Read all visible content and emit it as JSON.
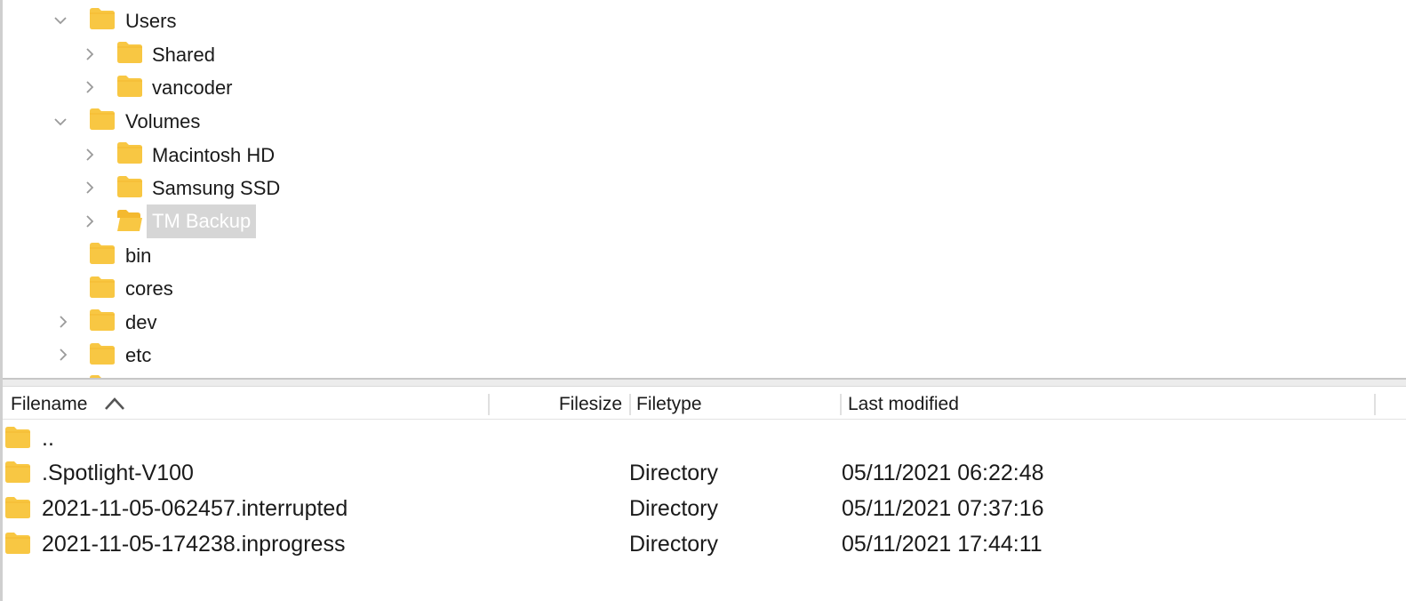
{
  "colors": {
    "folder": "#f8c743",
    "folder_tab": "#f4b92f",
    "selection_bg": "#d6d6d6",
    "chevron": "#9a9a9a"
  },
  "tree": {
    "items": [
      {
        "label": "Users",
        "expanded": true,
        "has_children": true
      },
      {
        "label": "Shared",
        "expanded": false,
        "has_children": true
      },
      {
        "label": "vancoder",
        "expanded": false,
        "has_children": true
      },
      {
        "label": "Volumes",
        "expanded": true,
        "has_children": true
      },
      {
        "label": "Macintosh HD",
        "expanded": false,
        "has_children": true
      },
      {
        "label": "Samsung SSD",
        "expanded": false,
        "has_children": true
      },
      {
        "label": "TM Backup",
        "expanded": false,
        "has_children": true,
        "selected": true,
        "open_folder": true
      },
      {
        "label": "bin",
        "has_children": false
      },
      {
        "label": "cores",
        "has_children": false
      },
      {
        "label": "dev",
        "expanded": false,
        "has_children": true
      },
      {
        "label": "etc",
        "expanded": false,
        "has_children": true
      }
    ]
  },
  "list": {
    "columns": {
      "filename": "Filename",
      "filesize": "Filesize",
      "filetype": "Filetype",
      "modified": "Last modified"
    },
    "sort": {
      "column": "filename",
      "direction": "ascending",
      "icon": "chevron-up-icon"
    },
    "rows": [
      {
        "name": "..",
        "size": "",
        "type": "",
        "modified": ""
      },
      {
        "name": ".Spotlight-V100",
        "size": "",
        "type": "Directory",
        "modified": "05/11/2021 06:22:48"
      },
      {
        "name": "2021-11-05-062457.interrupted",
        "size": "",
        "type": "Directory",
        "modified": "05/11/2021 07:37:16"
      },
      {
        "name": "2021-11-05-174238.inprogress",
        "size": "",
        "type": "Directory",
        "modified": "05/11/2021 17:44:11"
      }
    ]
  }
}
